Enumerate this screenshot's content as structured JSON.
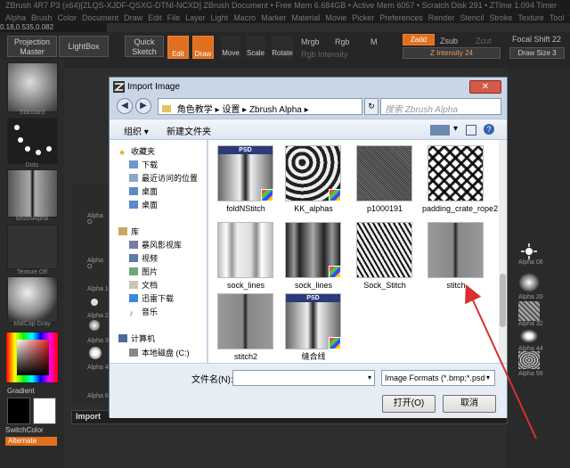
{
  "app": {
    "title_line": "ZBrush 4R7 P3 (x64)[ZLQS-XJDF-QSXG-DTNI-NCXD]   ZBrush Document   • Free Mem 6.684GB • Active Mem 6057 • Scratch Disk 291 • ZTime 1.094 Timer",
    "menus": [
      "Alpha",
      "Brush",
      "Color",
      "Document",
      "Draw",
      "Edit",
      "File",
      "Layer",
      "Light",
      "Macro",
      "Marker",
      "Material",
      "Movie",
      "Picker",
      "Preferences",
      "Render",
      "Stencil",
      "Stroke",
      "Texture",
      "Tool",
      "Transform",
      "Zplugin"
    ],
    "coords": "0.18,0.535,0.082"
  },
  "toolbar": {
    "projection_master": "Projection Master",
    "lightbox": "LightBox",
    "quick_sketch": "Quick Sketch",
    "edit": "Edit",
    "draw": "Draw",
    "move": "Move",
    "scale": "Scale",
    "rotate": "Rotate",
    "mrgb": "Mrgb",
    "rgb": "Rgb",
    "m": "M",
    "rgb_intensity": "Rgb Intensity",
    "zadd": "Zadd",
    "zsub": "Zsub",
    "zcut": "Zcut",
    "z_intensity": "Z Intensity 24",
    "focal_shift": "Focal Shift 22",
    "draw_size": "Draw Size 3"
  },
  "left": {
    "standard": "Standard",
    "dots": "Dots",
    "brush_alpha": "BrushAlpha",
    "texture_off": "Texture Off",
    "matcap": "MatCap Gray",
    "gradient": "Gradient",
    "switch_color": "SwitchColor",
    "alternate": "Alternate",
    "import": "Import"
  },
  "right": {
    "labels": [
      "Alpha 08",
      "Alpha 20",
      "Alpha 32",
      "Alpha 44",
      "Alpha 56"
    ],
    "left_labels": [
      "Alpha O",
      "Alpha O",
      "Alpha 1",
      "Alpha 2",
      "Alpha 3",
      "Alpha 4",
      "Alpha 6"
    ]
  },
  "dialog": {
    "title": "Import Image",
    "close": "✕",
    "path": [
      "角色教学",
      "设置",
      "Zbrush Alpha"
    ],
    "search_placeholder": "搜索 Zbrush Alpha",
    "organize": "组织 ▾",
    "new_folder": "新建文件夹",
    "nav": {
      "favorites": "收藏夹",
      "fav_items": [
        "下载",
        "最近访问的位置",
        "桌面",
        "桌面"
      ],
      "library": "库",
      "lib_items": [
        "暴风影视库",
        "视频",
        "图片",
        "文档",
        "迅雷下载",
        "音乐"
      ],
      "computer": "计算机",
      "comp_items": [
        "本地磁盘 (C:)"
      ]
    },
    "files": [
      {
        "name": "foldNStitch",
        "type": "psd"
      },
      {
        "name": "KK_alphas",
        "type": "pattern"
      },
      {
        "name": "p1000191",
        "type": "noise"
      },
      {
        "name": "padding_crate_rope2",
        "type": "grid"
      },
      {
        "name": "sock_lines",
        "type": "lines"
      },
      {
        "name": "sock_lines",
        "type": "lines-dark"
      },
      {
        "name": "Sock_Stitch",
        "type": "stripes"
      },
      {
        "name": "stitch",
        "type": "stitch"
      },
      {
        "name": "stitch2",
        "type": "stitch"
      },
      {
        "name": "缝合线",
        "type": "psd"
      }
    ],
    "psd_badge": "PSD",
    "filename_label": "文件名(N):",
    "filename_value": "",
    "filetype": "Image Formats (*.bmp;*.psd",
    "open": "打开(O)",
    "cancel": "取消"
  },
  "colors": {
    "accent_orange": "#e07020",
    "dialog_bg": "#c9d6e6",
    "arrow_red": "#d83030"
  }
}
